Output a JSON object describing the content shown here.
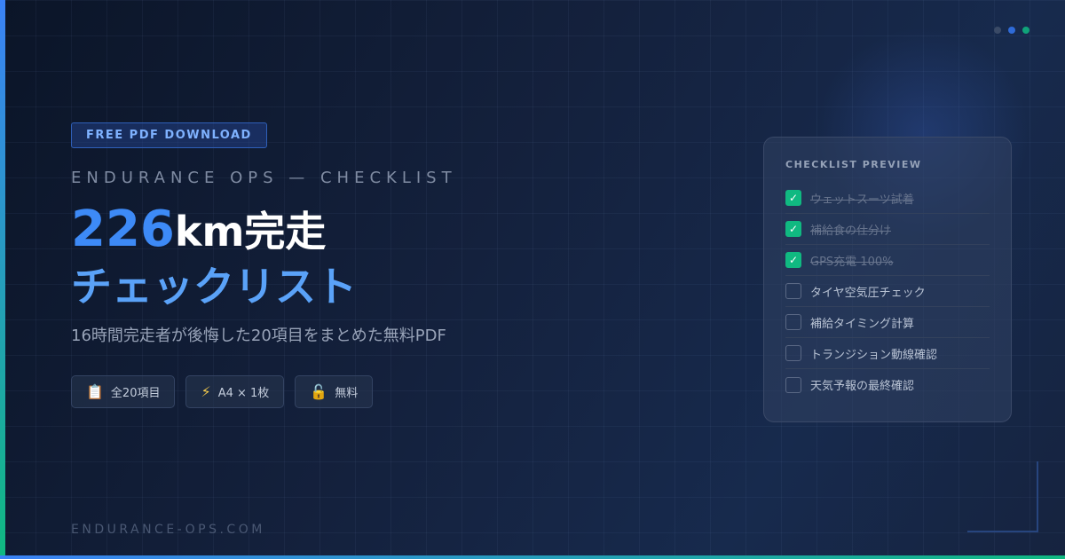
{
  "badge": "FREE PDF DOWNLOAD",
  "kicker": "ENDURANCE OPS — CHECKLIST",
  "headline": {
    "number": "226",
    "rest": "km完走",
    "line2": "チェックリスト"
  },
  "description": "16時間完走者が後悔した20項目をまとめた無料PDF",
  "pills": [
    {
      "icon": "clipboard-icon",
      "glyph": "📋",
      "label": "全20項目"
    },
    {
      "icon": "lightning-icon",
      "glyph": "⚡",
      "label": "A4 × 1枚"
    },
    {
      "icon": "unlock-icon",
      "glyph": "🔓",
      "label": "無料"
    }
  ],
  "footer": "ENDURANCE-OPS.COM",
  "card": {
    "title": "CHECKLIST PREVIEW",
    "items": [
      {
        "label": "ウェットスーツ試着",
        "checked": true
      },
      {
        "label": "補給食の仕分け",
        "checked": true
      },
      {
        "label": "GPS充電 100%",
        "checked": true
      },
      {
        "label": "タイヤ空気圧チェック",
        "checked": false
      },
      {
        "label": "補給タイミング計算",
        "checked": false
      },
      {
        "label": "トランジション動線確認",
        "checked": false
      },
      {
        "label": "天気予報の最終確認",
        "checked": false
      }
    ]
  },
  "colors": {
    "accent_blue": "#3d8af7",
    "accent_green": "#10b981",
    "background": "#14213d"
  }
}
